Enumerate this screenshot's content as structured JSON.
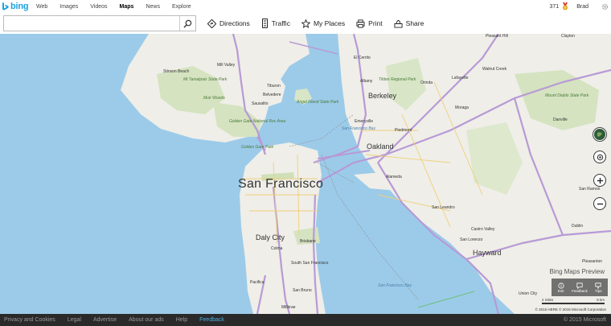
{
  "brand": {
    "logo_text": "bing",
    "accent": "#1ba1e2"
  },
  "nav": {
    "items": [
      {
        "label": "Web",
        "active": false
      },
      {
        "label": "Images",
        "active": false
      },
      {
        "label": "Videos",
        "active": false
      },
      {
        "label": "Maps",
        "active": true
      },
      {
        "label": "News",
        "active": false
      },
      {
        "label": "Explore",
        "active": false
      }
    ],
    "points": "371",
    "user": "Brad"
  },
  "toolbar": {
    "search_value": "",
    "search_placeholder": "",
    "tools": [
      {
        "label": "Directions",
        "icon": "directions-icon"
      },
      {
        "label": "Traffic",
        "icon": "traffic-icon"
      },
      {
        "label": "My Places",
        "icon": "star-icon"
      },
      {
        "label": "Print",
        "icon": "print-icon"
      },
      {
        "label": "Share",
        "icon": "share-icon"
      }
    ]
  },
  "map": {
    "labels": {
      "san_francisco": "San Francisco",
      "oakland": "Oakland",
      "berkeley": "Berkeley",
      "alameda": "Alameda",
      "daly_city": "Daly City",
      "hayward": "Hayward",
      "mill_valley": "Mill Valley",
      "sausalito": "Sausalito",
      "tiburon": "Tiburon",
      "belvedere": "Belvedere",
      "el_cerrito": "El Cerrito",
      "albany": "Albany",
      "emeryville": "Emeryville",
      "piedmont": "Piedmont",
      "orinda": "Orinda",
      "lafayette": "Lafayette",
      "moraga": "Moraga",
      "walnut_creek": "Walnut Creek",
      "clayton": "Clayton",
      "pleasant_hill": "Pleasant Hill",
      "san_leandro": "San Leandro",
      "castro_valley": "Castro Valley",
      "dublin": "Dublin",
      "pleasanton": "Pleasanton",
      "san_ramon": "San Ramon",
      "danville": "Danville",
      "south_sf": "South San Francisco",
      "colma": "Colma",
      "brisbane": "Brisbane",
      "pacifica": "Pacifica",
      "san_bruno": "San Bruno",
      "millbrae": "Millbrae",
      "san_lorenzo": "San Lorenzo",
      "union_city": "Union City",
      "stinson_beach": "Stinson Beach",
      "mt_tam": "Mt Tamalpais State Park",
      "muir_woods": "Muir Woods",
      "golden_gate_nra": "Golden Gate National Rec Area",
      "golden_gate_park": "Golden Gate Park",
      "mt_diablo": "Mount Diablo State Park",
      "angel_island": "Angel Island State Park",
      "tilden": "Tilden Regional Park",
      "sf_bay": "San Francisco Bay",
      "sf_bay_south": "San Francisco Bay"
    },
    "preview_label": "Bing Maps Preview",
    "panel": [
      {
        "label": "Exit",
        "icon": "info-icon"
      },
      {
        "label": "Feedback",
        "icon": "feedback-icon"
      },
      {
        "label": "Tips",
        "icon": "tips-icon"
      }
    ],
    "scale_left": "2 miles",
    "scale_right": "5 km",
    "copyright": "© 2015 HERE © 2015 Microsoft Corporation"
  },
  "footer": {
    "links": [
      {
        "label": "Privacy and Cookies",
        "highlight": false
      },
      {
        "label": "Legal",
        "highlight": false
      },
      {
        "label": "Advertise",
        "highlight": false
      },
      {
        "label": "About our ads",
        "highlight": false
      },
      {
        "label": "Help",
        "highlight": false
      },
      {
        "label": "Feedback",
        "highlight": true
      }
    ],
    "copyright": "© 2015 Microsoft"
  }
}
